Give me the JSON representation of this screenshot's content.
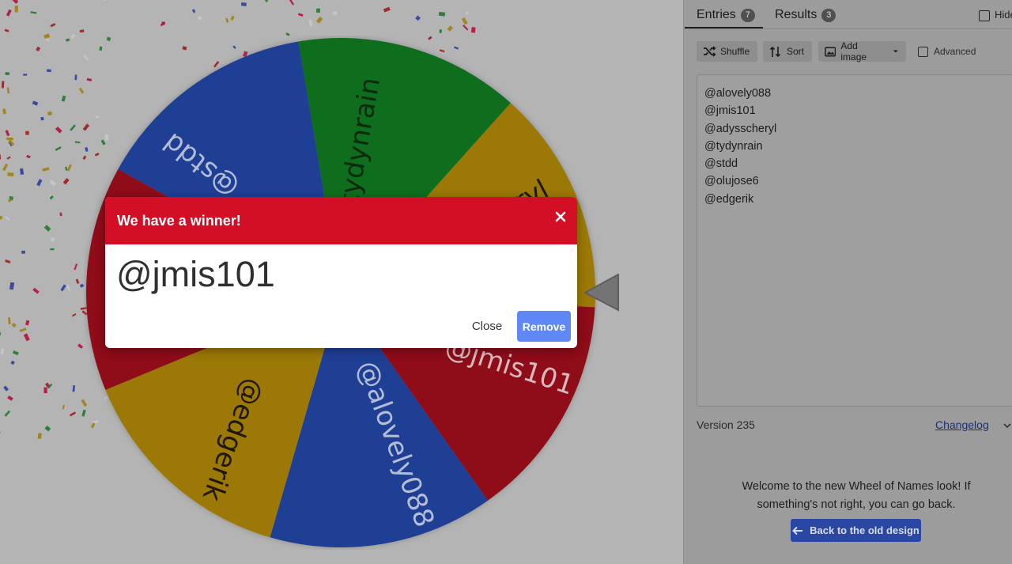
{
  "dialog": {
    "title": "We have a winner!",
    "winner": "@jmis101",
    "close_label": "Close",
    "remove_label": "Remove",
    "header_color": "#d20f24",
    "remove_color": "#5f87f5"
  },
  "wheel": {
    "segment_colors": [
      "#1f3f95",
      "#0f6e1d",
      "#9c7906",
      "#8f0c19",
      "#1f3f95",
      "#9c7906",
      "#8f0c19"
    ],
    "labels": [
      "@stdd",
      "@tydynrain",
      "@adysscheryl",
      "@jmis101",
      "@alovely088",
      "@edgerik",
      "@olujose6"
    ],
    "visible_label_text": [
      "@stdd",
      "@tydynrain",
      "ryl",
      "@jmis101",
      "@alovely088",
      "@edgerik"
    ]
  },
  "tabs": {
    "entries_label": "Entries",
    "entries_count": "7",
    "results_label": "Results",
    "results_count": "3",
    "hide_label": "Hide"
  },
  "toolbar": {
    "shuffle": "Shuffle",
    "sort": "Sort",
    "add_image": "Add image",
    "advanced": "Advanced"
  },
  "entries": [
    "@alovely088",
    "@jmis101",
    "@adysscheryl",
    "@tydynrain",
    "@stdd",
    "@olujose6",
    "@edgerik"
  ],
  "footer": {
    "version": "Version 235",
    "changelog": "Changelog",
    "welcome": "Welcome to the new Wheel of Names look! If something's not right, you can go back.",
    "back_button": "Back to the old design"
  }
}
